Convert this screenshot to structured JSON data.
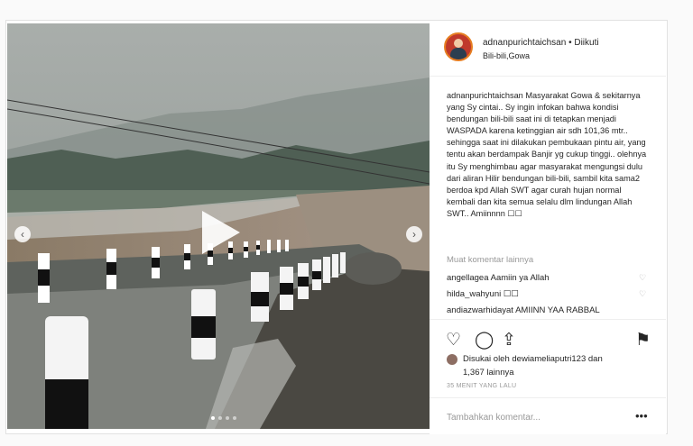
{
  "post": {
    "username": "adnanpurichtaichsan",
    "follow_status": "• Diikuti",
    "location": "Bili-bili,Gowa",
    "caption_user": "adnanpurichtaichsan",
    "caption_text": "Masyarakat Gowa & sekitarnya yang Sy cintai.. Sy ingin infokan bahwa kondisi bendungan bili-bili saat ini di tetapkan menjadi WASPADA karena ketinggian air sdh 101,36 mtr.. sehingga saat ini dilakukan pembukaan pintu air, yang tentu akan berdampak Banjir yg cukup tinggi.. olehnya itu Sy menghimbau agar masyarakat mengungsi dulu dari aliran Hilir bendungan bili-bili, sambil kita sama2 berdoa kpd Allah SWT agar curah hujan normal kembali dan kita semua selalu dlm lindungan Allah SWT.. Amiinnnn ☐☐",
    "load_more": "Muat komentar lainnya",
    "comments": [
      {
        "user": "angellagea",
        "text": "Aamiin ya Allah"
      },
      {
        "user": "hilda_wahyuni",
        "text": "☐☐"
      },
      {
        "user": "andiazwarhidayat",
        "text": "AMIINN YAA RABBAL"
      }
    ],
    "liked_by_prefix": "Disukai oleh",
    "liked_by_user": "dewiameliaputri123",
    "liked_by_suffix": "dan",
    "likes_count": "1,367 lainnya",
    "time_ago": "35 MENIT YANG LALU",
    "add_comment_placeholder": "Tambahkan komentar...",
    "options": "•••"
  },
  "icons": {
    "heart": "♡",
    "comment": "◯",
    "share": "⇪",
    "bookmark": "⚑",
    "prev": "‹",
    "next": "›"
  },
  "carousel": {
    "slides": 4,
    "active": 1
  }
}
